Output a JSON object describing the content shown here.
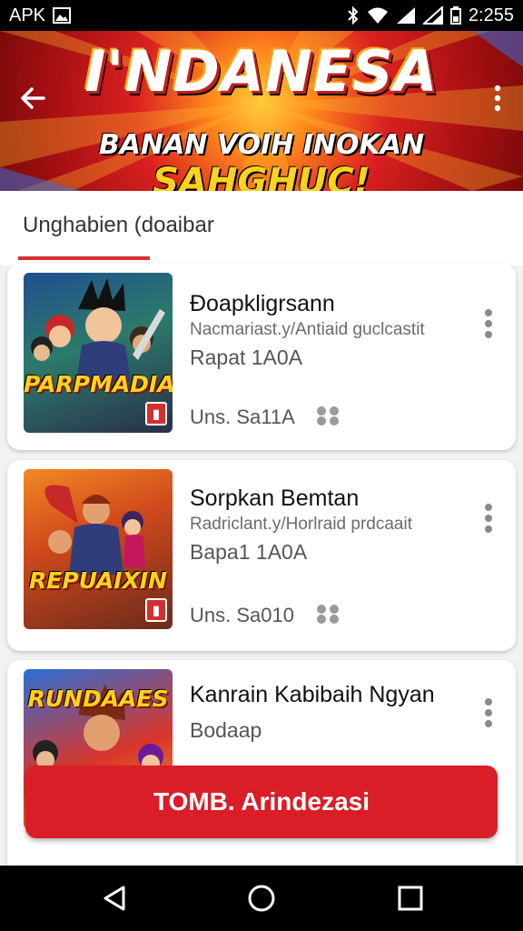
{
  "status_bar": {
    "left_text": "APK",
    "time": "2:255"
  },
  "banner": {
    "title": "I'NDANESA",
    "subtitle_prefix": "BANAN VOIH INOKAN",
    "subtitle_accent": "SAHGHUC!"
  },
  "tabs": [
    {
      "label": "Unghabien (doaibar"
    }
  ],
  "games": [
    {
      "title": "Đoapkligrsann",
      "subtitle": "Nacmariast.y/Antiaid guclcastit",
      "meta": "Rapat 1A0A",
      "footer": "Uns. Sa11A",
      "thumb_label": "PARPMADIA"
    },
    {
      "title": "Sorpkan Bemtan",
      "subtitle": "Radriclant.y/Horlraid prdcaait",
      "meta": "Bapa1 1A0A",
      "footer": "Uns. Sa010",
      "thumb_label": "REPUAIXIN"
    },
    {
      "title": "Kanrain Kabibaih Ngyan",
      "subtitle": "Bodaap",
      "thumb_label": "RUNDAAES"
    }
  ],
  "cta": {
    "label": "TOMB. Arindezasi"
  },
  "colors": {
    "accent": "#d91e28",
    "banner_red": "#d92020",
    "yellow": "#ffd21c"
  },
  "icons": [
    "back-icon",
    "more-vert-icon",
    "grid-dots-icon",
    "back-nav-icon",
    "home-nav-icon",
    "recents-nav-icon"
  ]
}
